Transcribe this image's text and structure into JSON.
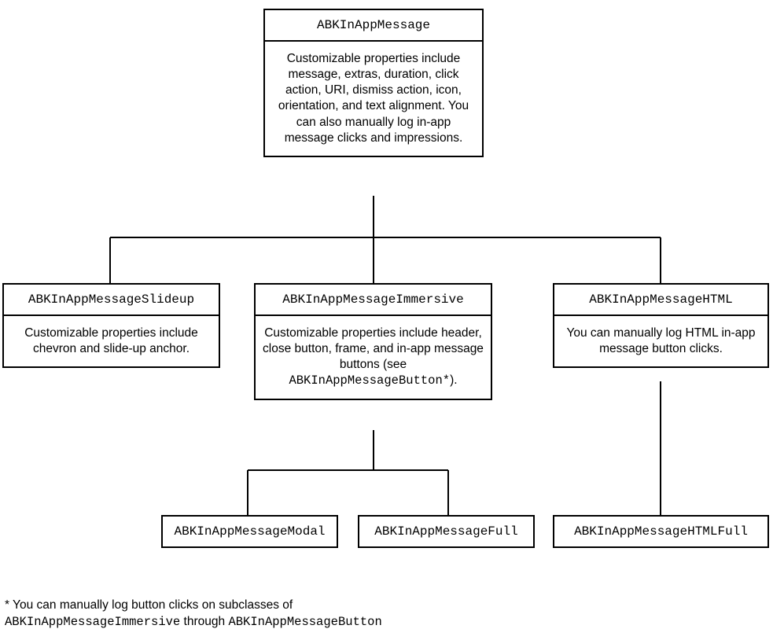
{
  "root": {
    "title": "ABKInAppMessage",
    "desc": "Customizable properties include message, extras, duration, click action, URI, dismiss action, icon, orientation, and text alignment. You can also manually log in-app message clicks and impressions."
  },
  "slideup": {
    "title": "ABKInAppMessageSlideup",
    "desc": "Customizable properties include chevron and slide-up anchor."
  },
  "immersive": {
    "title": "ABKInAppMessageImmersive",
    "desc_pre": "Customizable properties include header, close button, frame, and in-app message buttons (see ",
    "desc_code": "ABKInAppMessageButton*",
    "desc_post": ")."
  },
  "html": {
    "title": "ABKInAppMessageHTML",
    "desc": "You can manually log HTML in-app message button clicks."
  },
  "modal": {
    "title": "ABKInAppMessageModal"
  },
  "full": {
    "title": "ABKInAppMessageFull"
  },
  "htmlfull": {
    "title": "ABKInAppMessageHTMLFull"
  },
  "footnote": {
    "pre": "* You can manually log button clicks on subclasses of ",
    "code1": "ABKInAppMessageImmersive",
    "mid": " through ",
    "code2": "ABKInAppMessageButton"
  }
}
